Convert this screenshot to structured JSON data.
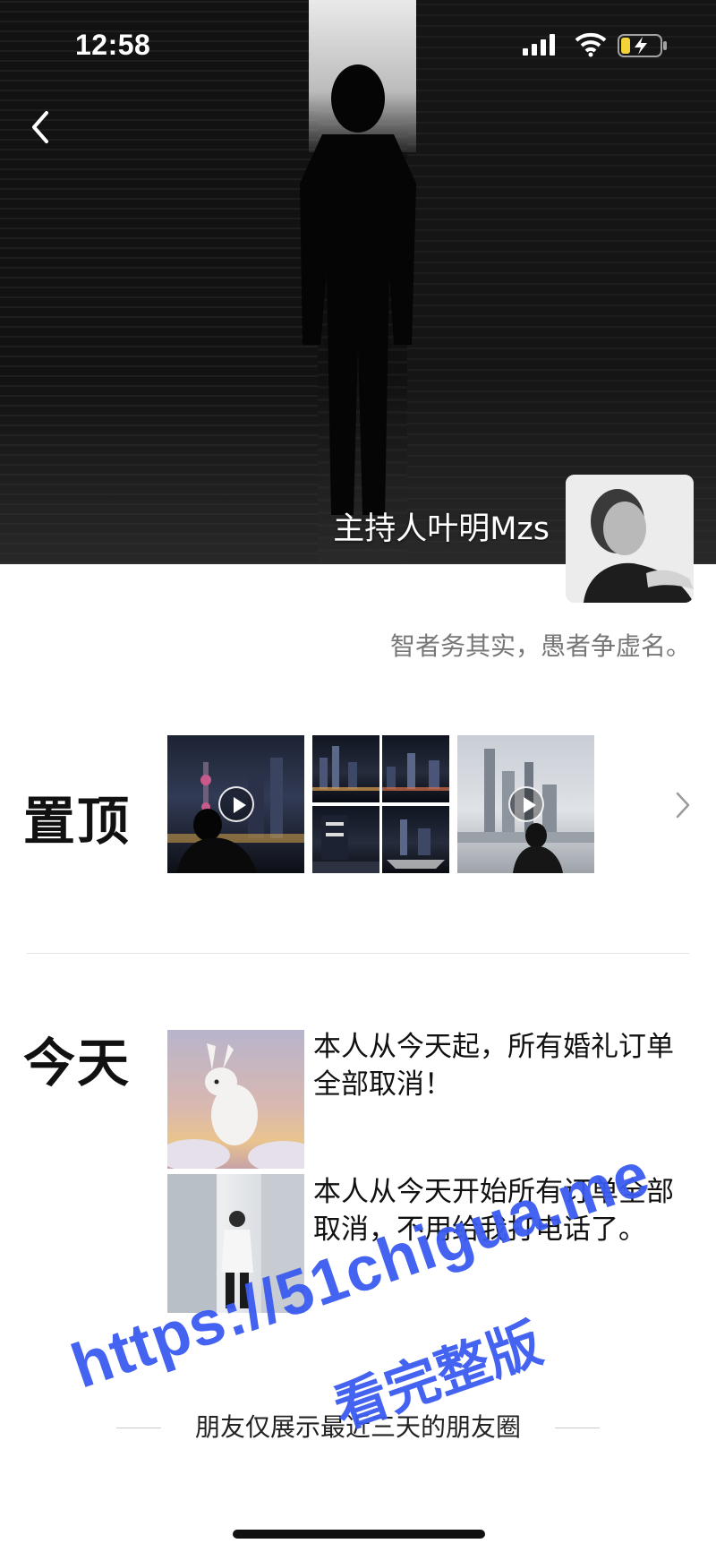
{
  "status_bar": {
    "time": "12:58",
    "signal_icon": "cellular-signal-icon",
    "wifi_icon": "wifi-icon",
    "battery_icon": "battery-charging-icon"
  },
  "header": {
    "back_icon": "chevron-left-icon",
    "username": "主持人叶明Mzs",
    "signature": "智者务其实，愚者争虚名。"
  },
  "pinned": {
    "label": "置顶",
    "more_icon": "chevron-right-icon"
  },
  "today": {
    "label": "今天",
    "posts": [
      {
        "text": "本人从今天起，所有婚礼订单全部取消！"
      },
      {
        "text": "本人从今天开始所有订单全部取消，不用给我打电话了。"
      }
    ]
  },
  "footer": {
    "text": "朋友仅展示最近三天的朋友圈"
  },
  "watermark": {
    "line1": "https://51chigua.me",
    "line2": "看完整版"
  },
  "colors": {
    "watermark": "#3b5bf0",
    "signature": "#777777"
  }
}
